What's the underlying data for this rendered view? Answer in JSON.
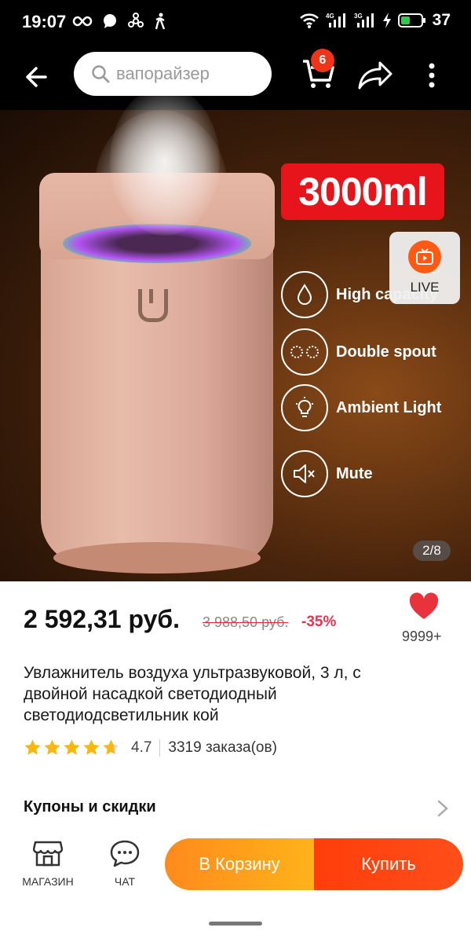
{
  "status_bar": {
    "time": "19:07",
    "battery": "37"
  },
  "header": {
    "search_placeholder": "вапорайзер",
    "cart_count": "6"
  },
  "gallery": {
    "promo_text": "3000ml",
    "features": [
      "High capacity",
      "Double spout",
      "Ambient Light",
      "Mute"
    ],
    "live_label": "LIVE",
    "pager": "2/8"
  },
  "product": {
    "price": "2 592,31 руб.",
    "old_price": "3 988,50 руб.",
    "discount": "-35%",
    "likes": "9999+",
    "title": "Увлажнитель воздуха ультразвуковой, 3 л, с двойной насадкой светодиодный светодиодсветильник кой",
    "rating": "4.7",
    "rating_fraction": 0.94,
    "orders": "3319 заказа(ов)",
    "coupons_label": "Купоны и скидки"
  },
  "bottom_bar": {
    "store_label": "МАГАЗИН",
    "chat_label": "ЧАТ",
    "cart_button": "В Корзину",
    "buy_button": "Купить"
  },
  "colors": {
    "accent_red": "#f0341a",
    "cart_orange": "#ff9d1a",
    "buy_red": "#ff4414",
    "discount_pink": "#e8324e"
  }
}
